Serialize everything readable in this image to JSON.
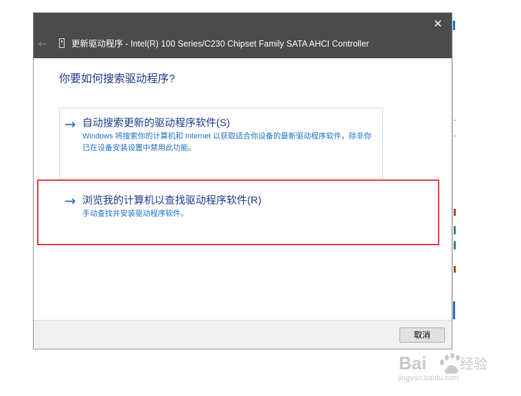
{
  "dialog": {
    "title": "更新驱动程序 - Intel(R) 100 Series/C230 Chipset Family SATA AHCI Controller",
    "close_glyph": "✕",
    "back_glyph": "←",
    "heading": "你要如何搜索驱动程序?"
  },
  "options": [
    {
      "arrow": "→",
      "title": "自动搜索更新的驱动程序软件(S)",
      "description": "Windows 将搜索你的计算机和 Internet 以获取适合你设备的最新驱动程序软件，除非你已在设备安装设置中禁用此功能。"
    },
    {
      "arrow": "→",
      "title": "浏览我的计算机以查找驱动程序软件(R)",
      "description": "手动查找并安装驱动程序软件。"
    }
  ],
  "footer": {
    "cancel_label": "取消"
  },
  "watermark": {
    "logo_text": "Bai",
    "logo_text_2": "经验",
    "url": "jingyan.baidu.com"
  },
  "colors": {
    "titlebar": "#4b4b4b",
    "heading": "#1c3a8c",
    "link": "#1e6fc2",
    "highlight": "#e0393e"
  },
  "icons": {
    "close": "close-icon",
    "back": "back-arrow-icon",
    "device": "device-icon",
    "option_arrow": "arrow-right-icon",
    "watermark": "baidu-paw-icon"
  }
}
